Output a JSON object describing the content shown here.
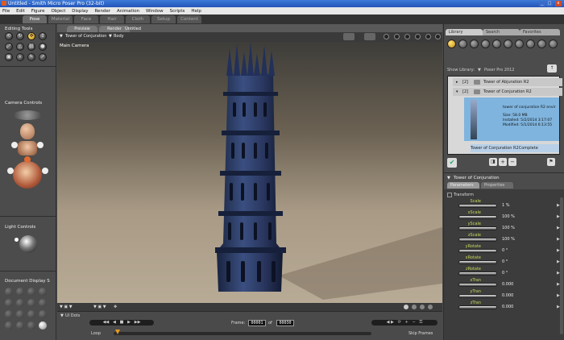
{
  "window": {
    "title": "Untitled - Smith Micro Poser Pro (32-bit)",
    "minimize": "_",
    "maximize": "□",
    "close": "x"
  },
  "menu": [
    "File",
    "Edit",
    "Figure",
    "Object",
    "Display",
    "Render",
    "Animation",
    "Window",
    "Scripts",
    "Help"
  ],
  "rooms": [
    "Pose",
    "Material",
    "Face",
    "Hair",
    "Cloth",
    "Setup",
    "Content"
  ],
  "left": {
    "editing_tools_title": "Editing Tools",
    "camera_controls_title": "Camera Controls",
    "light_controls_title": "Light Controls",
    "document_display_title": "Document Display S"
  },
  "document": {
    "tabs": [
      "Preview",
      "Render",
      "Untitled"
    ],
    "actor_menu": "Tower of Conjuration",
    "body_menu": "Body",
    "camera_label": "Main Camera"
  },
  "animation": {
    "ui_dots": "UI Dots",
    "frame_label": "Frame:",
    "frame_current": "00001",
    "frame_of": "of",
    "frame_total": "00030",
    "loop_label": "Loop",
    "skip_frames": "Skip Frames"
  },
  "library": {
    "tabs": [
      "Library",
      "Search",
      "Favorites"
    ],
    "show_library_label": "Show Library:",
    "show_library_value": "Poser Pro 2012",
    "items": [
      {
        "count": "[2]",
        "name": "Tower of Abjuration R2"
      },
      {
        "count": "[2]",
        "name": "Tower of Conjuration R2"
      }
    ],
    "preview": {
      "name": "tower of conjuration R2 envir",
      "size": "Size: 58.0 MB",
      "installed": "Installed: 5/2/2014 3:17:07",
      "modified": "Modified: 5/1/2014 6:13:55"
    },
    "selected_item": "Tower of Conjuration R2Complete"
  },
  "params": {
    "title": "Tower of Conjuration",
    "tabs": [
      "Parameters",
      "Properties"
    ],
    "group": "Transform",
    "list": [
      {
        "name": "Scale",
        "value": "1 %"
      },
      {
        "name": "xScale",
        "value": "100 %"
      },
      {
        "name": "yScale",
        "value": "100 %"
      },
      {
        "name": "zScale",
        "value": "100 %"
      },
      {
        "name": "yRotate",
        "value": "0 °"
      },
      {
        "name": "xRotate",
        "value": "0 °"
      },
      {
        "name": "zRotate",
        "value": "0 °"
      },
      {
        "name": "xTran",
        "value": "0.000"
      },
      {
        "name": "yTran",
        "value": "0.000"
      },
      {
        "name": "zTran",
        "value": "0.000"
      }
    ]
  },
  "colors": {
    "accent": "#e8b830",
    "selection": "#7fb4de",
    "viewport_floor": "#b8ab96"
  }
}
